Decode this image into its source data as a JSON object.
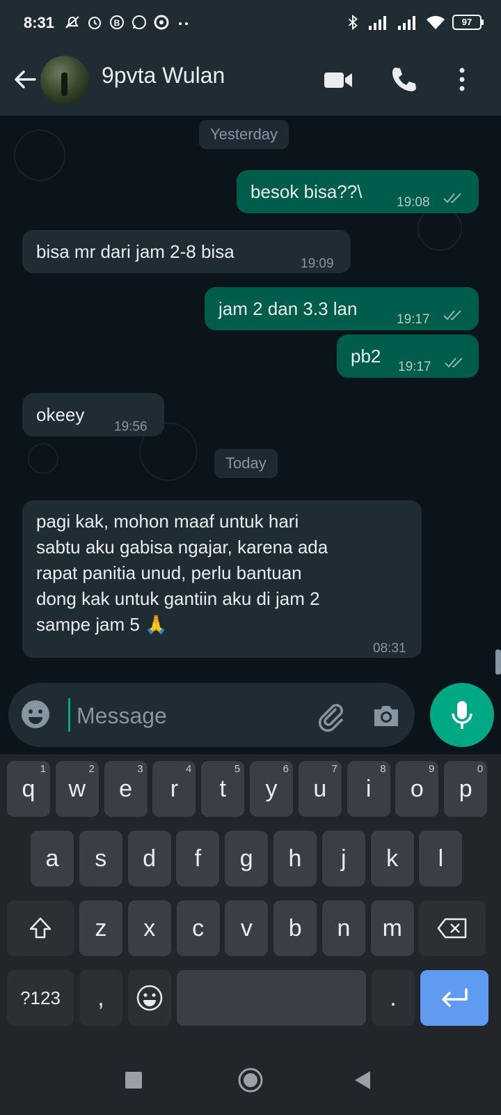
{
  "status_bar": {
    "time": "8:31",
    "battery": "97",
    "left_icons": [
      "mute-icon",
      "alarm-icon",
      "b-app-icon",
      "whatsapp-icon",
      "circle-app-icon",
      "more-dots-icon"
    ],
    "right_icons": [
      "bluetooth-icon",
      "signal-icon",
      "signal-icon",
      "wifi-icon"
    ]
  },
  "header": {
    "contact_name": "9pvta Wulan"
  },
  "chat": {
    "date_chips": [
      "Yesterday",
      "Today"
    ],
    "messages": [
      {
        "direction": "out",
        "text": "besok bisa??\\",
        "time": "19:08",
        "status": "read"
      },
      {
        "direction": "in",
        "text": "bisa mr dari jam 2-8 bisa",
        "time": "19:09"
      },
      {
        "direction": "out",
        "text": "jam 2 dan 3.3 lan",
        "time": "19:17",
        "status": "read"
      },
      {
        "direction": "out",
        "text": "pb2",
        "time": "19:17",
        "status": "read"
      },
      {
        "direction": "in",
        "text": "okeey",
        "time": "19:56"
      },
      {
        "direction": "in",
        "lines": [
          "pagi kak, mohon maaf untuk hari",
          "sabtu aku gabisa ngajar, karena ada",
          "rapat panitia unud, perlu bantuan",
          "dong kak untuk gantiin aku di jam 2",
          "sampe jam 5 🙏"
        ],
        "time": "08:31"
      }
    ]
  },
  "input": {
    "placeholder": "Message"
  },
  "keyboard": {
    "row1": [
      {
        "k": "q",
        "n": "1"
      },
      {
        "k": "w",
        "n": "2"
      },
      {
        "k": "e",
        "n": "3"
      },
      {
        "k": "r",
        "n": "4"
      },
      {
        "k": "t",
        "n": "5"
      },
      {
        "k": "y",
        "n": "6"
      },
      {
        "k": "u",
        "n": "7"
      },
      {
        "k": "i",
        "n": "8"
      },
      {
        "k": "o",
        "n": "9"
      },
      {
        "k": "p",
        "n": "0"
      }
    ],
    "row2": [
      "a",
      "s",
      "d",
      "f",
      "g",
      "h",
      "j",
      "k",
      "l"
    ],
    "row3": [
      "z",
      "x",
      "c",
      "v",
      "b",
      "n",
      "m"
    ],
    "row4": {
      "symbols": "?123",
      "comma": ",",
      "period": "."
    }
  },
  "colors": {
    "outgoing_bubble": "#005c4b",
    "incoming_bubble": "#202c33",
    "accent": "#00a884",
    "read_ticks": "#53bdeb"
  }
}
